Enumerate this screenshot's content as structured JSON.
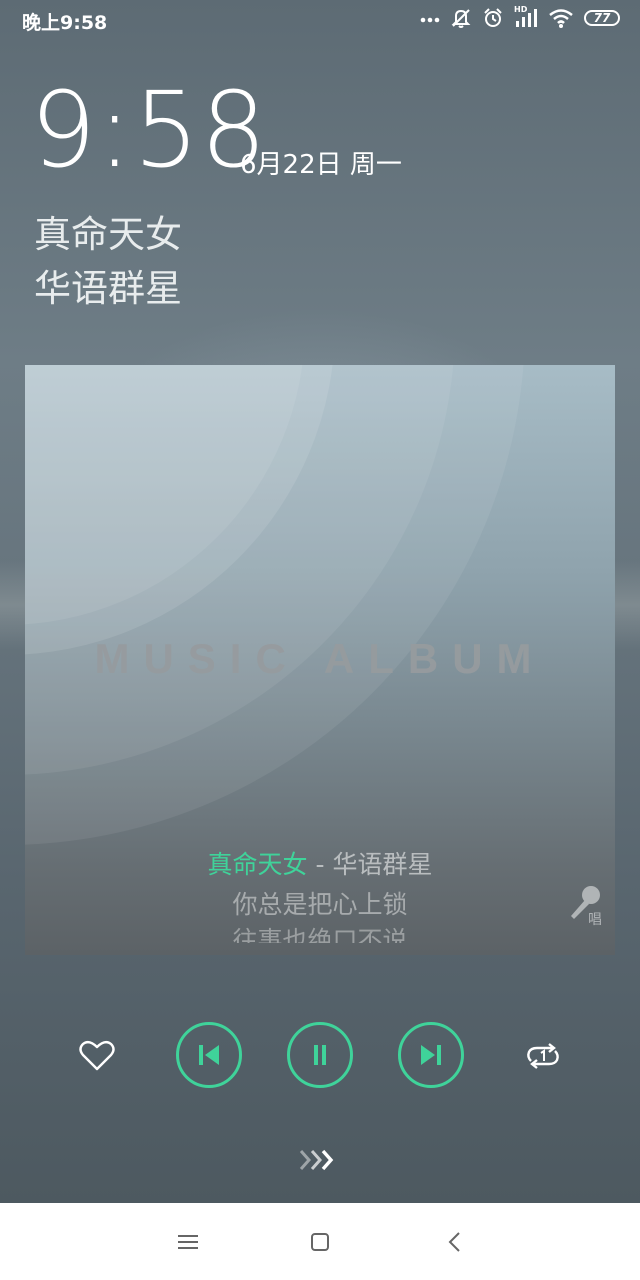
{
  "status_bar": {
    "time": "晚上9:58",
    "battery": "77",
    "hd_label": "HD",
    "icons": [
      "more-dots-icon",
      "mute-bell-icon",
      "alarm-icon",
      "signal-icon",
      "wifi-icon",
      "battery-icon"
    ]
  },
  "lockscreen": {
    "clock": "9:58",
    "date": "6月22日 周一"
  },
  "now_playing": {
    "title": "真命天女",
    "artist": "华语群星",
    "album_art_text": "MUSIC ALBUM",
    "lyric_title": "真命天女",
    "lyric_separator": " - ",
    "lyric_artist": "华语群星",
    "lyric_line_1": "你总是把心上锁",
    "lyric_line_2": "往事也绝口不说",
    "karaoke_label": "唱"
  },
  "controls": {
    "icons": [
      "heart-icon",
      "previous-icon",
      "pause-icon",
      "next-icon",
      "repeat-one-icon"
    ],
    "accent_color": "#3fd39a"
  },
  "navbar": {
    "icons": [
      "menu-icon",
      "home-icon",
      "back-icon"
    ]
  }
}
